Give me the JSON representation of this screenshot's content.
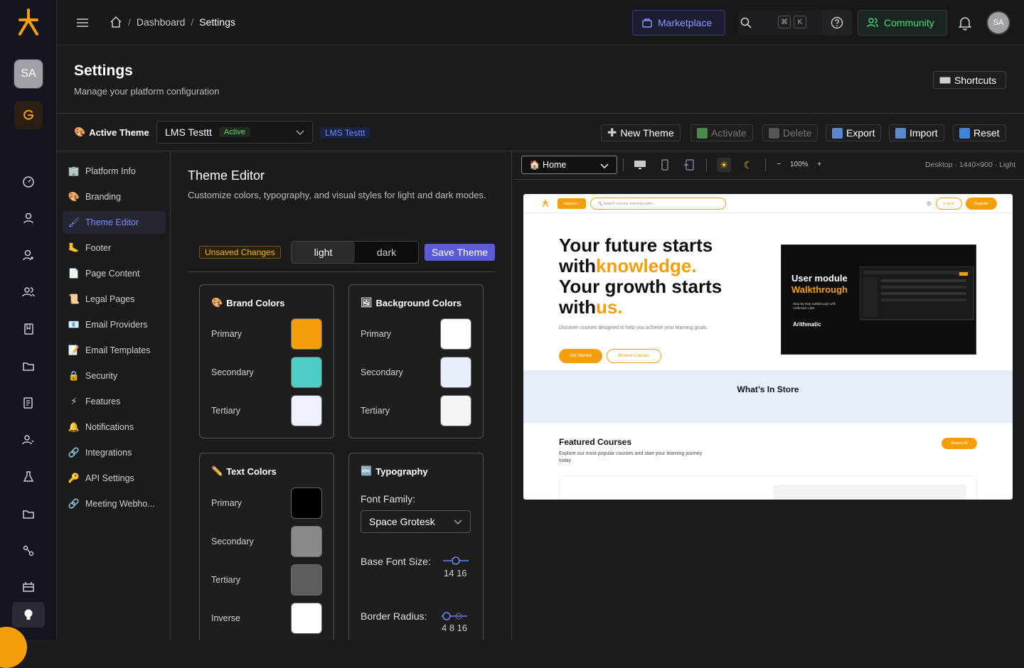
{
  "user": {
    "initials": "SA"
  },
  "breadcrumb": {
    "dashboard": "Dashboard",
    "sep": "/",
    "current": "Settings"
  },
  "topbar": {
    "marketplace": "Marketplace",
    "kbd_cmd": "⌘",
    "kbd_k": "K",
    "community": "Community"
  },
  "page": {
    "title": "Settings",
    "subtitle": "Manage your platform configuration",
    "shortcuts": "Shortcuts"
  },
  "theme_bar": {
    "label": "Active Theme",
    "selected": "LMS Testtt",
    "status": "Active",
    "tag": "LMS Testtt",
    "actions": {
      "new": "New Theme",
      "activate": "Activate",
      "delete": "Delete",
      "export": "Export",
      "import": "Import",
      "reset": "Reset"
    }
  },
  "sidebar": {
    "items": [
      {
        "label": "Platform Info",
        "icon": "🏢"
      },
      {
        "label": "Branding",
        "icon": "🎨"
      },
      {
        "label": "Theme Editor",
        "icon": "🖌"
      },
      {
        "label": "Footer",
        "icon": "🦶"
      },
      {
        "label": "Page Content",
        "icon": "📄"
      },
      {
        "label": "Legal Pages",
        "icon": "📜"
      },
      {
        "label": "Email Providers",
        "icon": "📧"
      },
      {
        "label": "Email Templates",
        "icon": "📝"
      },
      {
        "label": "Security",
        "icon": "🔒"
      },
      {
        "label": "Features",
        "icon": "⚡"
      },
      {
        "label": "Notifications",
        "icon": "🔔"
      },
      {
        "label": "Integrations",
        "icon": "🔗"
      },
      {
        "label": "API Settings",
        "icon": "🔑"
      },
      {
        "label": "Meeting Webho...",
        "icon": "🔗"
      }
    ]
  },
  "editor": {
    "title": "Theme Editor",
    "subtitle": "Customize colors, typography, and visual styles for light and dark modes.",
    "unsaved": "Unsaved Changes",
    "mode_light": "light",
    "mode_dark": "dark",
    "save": "Save Theme",
    "brand": {
      "title": "Brand Colors",
      "primary": "Primary",
      "secondary": "Secondary",
      "tertiary": "Tertiary",
      "c1": "#f59e0b",
      "c2": "#4ecdc4",
      "c3": "#eef2ff"
    },
    "background": {
      "title": "Background Colors",
      "primary": "Primary",
      "secondary": "Secondary",
      "tertiary": "Tertiary",
      "c1": "#ffffff",
      "c2": "#e8edfc",
      "c3": "#f5f5f5"
    },
    "text": {
      "title": "Text Colors",
      "primary": "Primary",
      "secondary": "Secondary",
      "tertiary": "Tertiary",
      "inverse": "Inverse",
      "c1": "#000000",
      "c2": "#8a8a8a",
      "c3": "#5e5e5e",
      "c4": "#ffffff"
    },
    "typography": {
      "title": "Typography",
      "font_family_label": "Font Family",
      "font_family": "Space Grotesk",
      "base_size_label": "Base Font Size",
      "base_size": "14 16",
      "radius_label": "Border Radius",
      "radius": "4 8 16",
      "colon": ":"
    }
  },
  "preview": {
    "page": "🏠 Home",
    "zoom": "100%",
    "zoom_minus": "−",
    "zoom_plus": "+",
    "meta": "Desktop · 1440×900 · Light",
    "site": {
      "explore": "Explore ›",
      "search": "🔍 Search courses, learning paths...",
      "login": "Log in",
      "register": "Register",
      "hero_1": "Your future starts with",
      "hero_1_acc": "knowledge.",
      "hero_2": "Your growth starts with",
      "hero_2_acc": "us.",
      "hero_desc": "Discover courses designed to help you achieve your learning goals.",
      "cta_start": "Get Started",
      "cta_browse": "Browse Courses",
      "video_t1": "User module",
      "video_t2": "Walkthrough",
      "video_t3": "Step-by-step walkthrough with Arithmatic LMS",
      "video_brand": "Arithmatic",
      "store": "What’s In Store",
      "featured": "Featured Courses",
      "featured_desc": "Explore our most popular courses and start your learning journey today",
      "browse_all": "Browse All"
    }
  }
}
